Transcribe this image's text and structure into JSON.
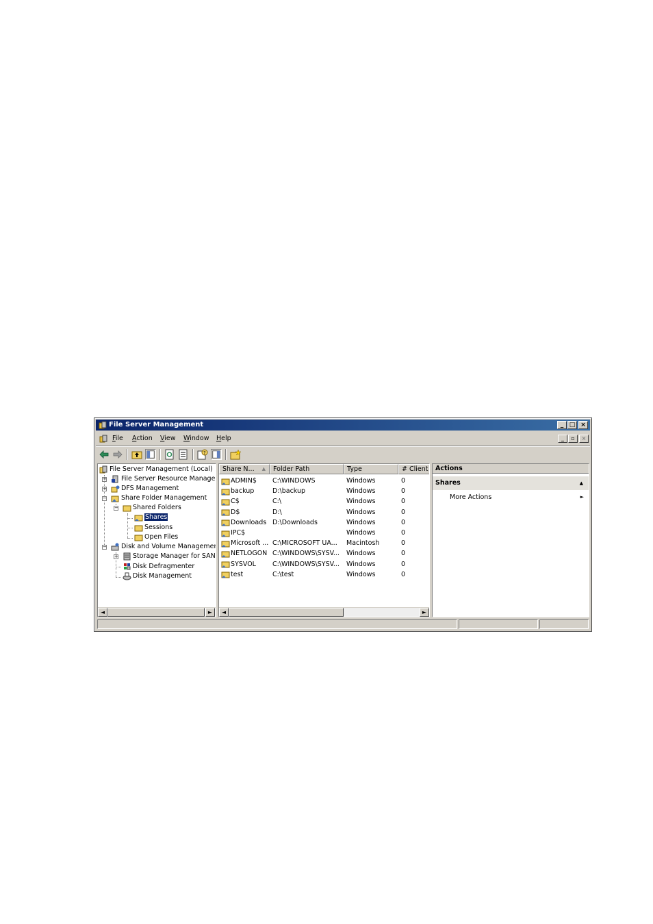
{
  "window": {
    "title": "File Server Management",
    "title_buttons": [
      "_",
      "□",
      "×"
    ],
    "mdi_buttons": [
      "_",
      "▫",
      "×"
    ]
  },
  "menu": {
    "items": [
      {
        "label": "File",
        "accel": "F",
        "rest": "ile"
      },
      {
        "label": "Action",
        "accel": "A",
        "rest": "ction"
      },
      {
        "label": "View",
        "accel": "V",
        "rest": "iew"
      },
      {
        "label": "Window",
        "accel": "W",
        "rest": "indow"
      },
      {
        "label": "Help",
        "accel": "H",
        "rest": "elp"
      }
    ]
  },
  "toolbar": {
    "icons": [
      "back-arrow-icon",
      "forward-arrow-icon",
      "up-folder-icon",
      "show-hide-tree-icon",
      "refresh-icon",
      "export-list-icon",
      "help-icon",
      "show-hide-action-pane-icon",
      "new-share-icon"
    ]
  },
  "tree": {
    "root": "File Server Management (Local)",
    "items": [
      {
        "label": "File Server Resource Manager",
        "expander": "+"
      },
      {
        "label": "DFS Management",
        "expander": "+"
      },
      {
        "label": "Share Folder Management",
        "expander": "−"
      },
      {
        "label": "Shared Folders",
        "expander": "−"
      },
      {
        "label": "Shares",
        "selected": true
      },
      {
        "label": "Sessions"
      },
      {
        "label": "Open Files"
      },
      {
        "label": "Disk and Volume Management",
        "expander": "−"
      },
      {
        "label": "Storage Manager for SANs",
        "expander": "+"
      },
      {
        "label": "Disk Defragmenter"
      },
      {
        "label": "Disk Management"
      }
    ]
  },
  "list": {
    "columns": [
      "Share N...",
      "Folder Path",
      "Type",
      "# Client C"
    ],
    "sort_indicator": "▲",
    "rows": [
      {
        "name": "ADMIN$",
        "path": "C:\\WINDOWS",
        "type": "Windows",
        "clients": "0"
      },
      {
        "name": "backup",
        "path": "D:\\backup",
        "type": "Windows",
        "clients": "0"
      },
      {
        "name": "C$",
        "path": "C:\\",
        "type": "Windows",
        "clients": "0"
      },
      {
        "name": "D$",
        "path": "D:\\",
        "type": "Windows",
        "clients": "0"
      },
      {
        "name": "Downloads",
        "path": "D:\\Downloads",
        "type": "Windows",
        "clients": "0"
      },
      {
        "name": "IPC$",
        "path": "",
        "type": "Windows",
        "clients": "0"
      },
      {
        "name": "Microsoft ...",
        "path": "C:\\MICROSOFT UA...",
        "type": "Macintosh",
        "clients": "0"
      },
      {
        "name": "NETLOGON",
        "path": "C:\\WINDOWS\\SYSV...",
        "type": "Windows",
        "clients": "0"
      },
      {
        "name": "SYSVOL",
        "path": "C:\\WINDOWS\\SYSV...",
        "type": "Windows",
        "clients": "0"
      },
      {
        "name": "test",
        "path": "C:\\test",
        "type": "Windows",
        "clients": "0"
      }
    ]
  },
  "actions": {
    "header": "Actions",
    "section": "Shares",
    "section_arrow": "▲",
    "items": [
      {
        "label": "More Actions",
        "arrow": "►"
      }
    ]
  },
  "scroll": {
    "left_arrow": "◄",
    "right_arrow": "►"
  }
}
